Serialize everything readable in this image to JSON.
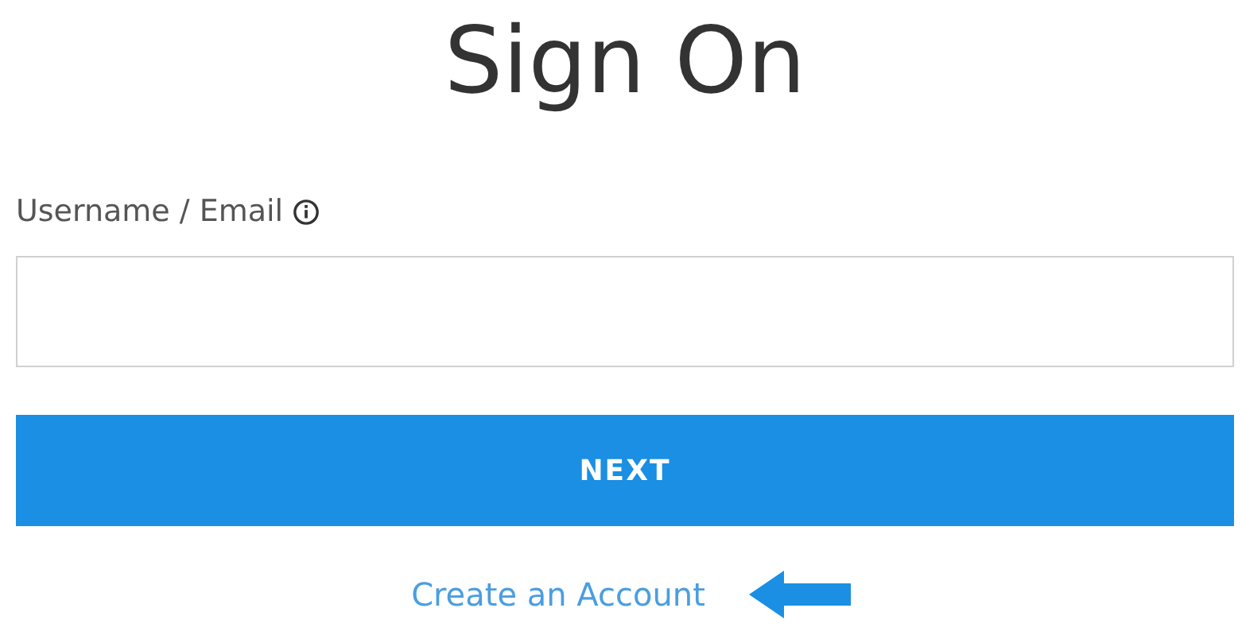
{
  "title": "Sign On",
  "username_field": {
    "label": "Username / Email"
  },
  "next_button": {
    "label": "NEXT"
  },
  "create_account_link": {
    "label": "Create an Account"
  }
}
